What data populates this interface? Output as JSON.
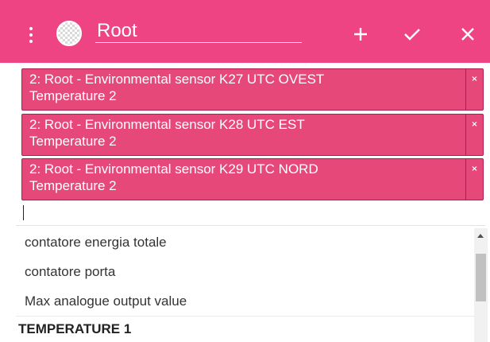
{
  "header": {
    "title_value": "Root",
    "add_icon": "plus-icon",
    "confirm_icon": "checkmark-icon",
    "close_icon": "close-icon",
    "menu_icon": "vertical-dots-icon",
    "accent_color": "#ee4483"
  },
  "tags": [
    {
      "line1": "2: Root - Environmental sensor K27 UTC OVEST",
      "line2": "Temperature 2",
      "remove": "×"
    },
    {
      "line1": "2: Root - Environmental sensor K28 UTC EST",
      "line2": "Temperature 2",
      "remove": "×"
    },
    {
      "line1": "2: Root - Environmental sensor K29 UTC NORD",
      "line2": "Temperature 2",
      "remove": "×"
    }
  ],
  "dropdown": {
    "options": [
      "contatore energia totale",
      "contatore porta",
      "Max analogue output value"
    ],
    "group_label": "TEMPERATURE 1"
  }
}
